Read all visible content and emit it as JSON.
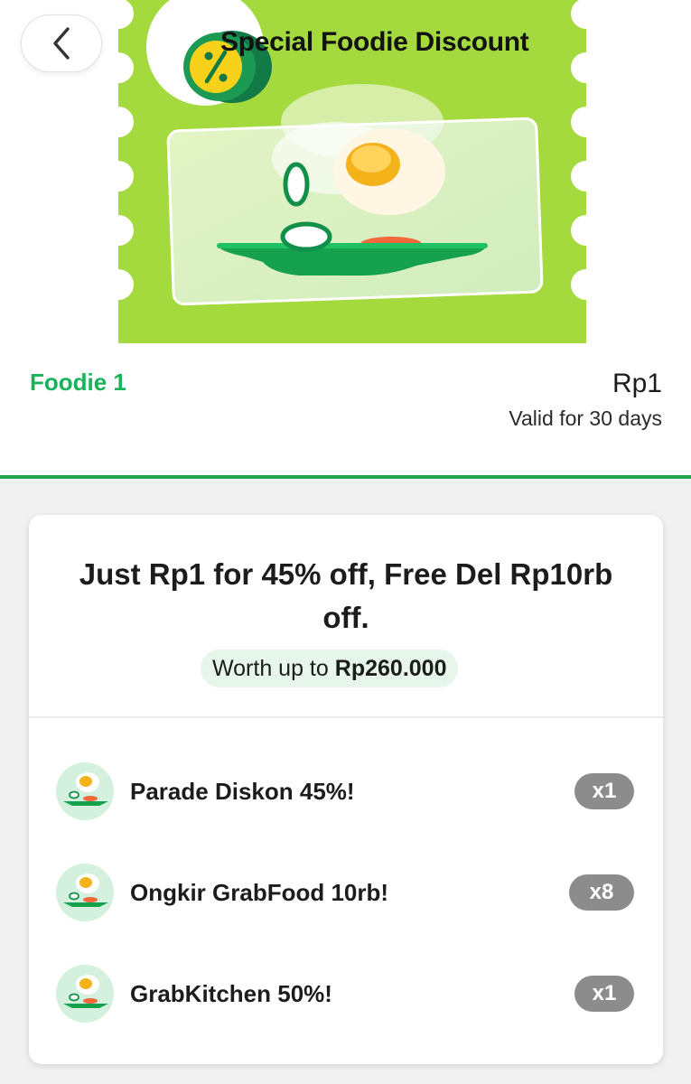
{
  "header": {
    "back_icon": "chevron-left-icon",
    "banner_title": "Special Foodie Discount",
    "colors": {
      "ticket": "#a4da3e",
      "brand_green": "#17b35b"
    }
  },
  "package": {
    "name": "Foodie 1",
    "price": "Rp1",
    "validity": "Valid for 30 days"
  },
  "card": {
    "headline": "Just Rp1 for 45% off, Free Del Rp10rb off.",
    "worth_prefix": "Worth up to",
    "worth_value": "Rp260.000",
    "items": [
      {
        "label": "Parade Diskon 45%!",
        "qty": "x1",
        "icon": "food-plate-icon"
      },
      {
        "label": "Ongkir GrabFood 10rb!",
        "qty": "x8",
        "icon": "food-plate-icon"
      },
      {
        "label": "GrabKitchen 50%!",
        "qty": "x1",
        "icon": "food-plate-icon"
      }
    ]
  }
}
